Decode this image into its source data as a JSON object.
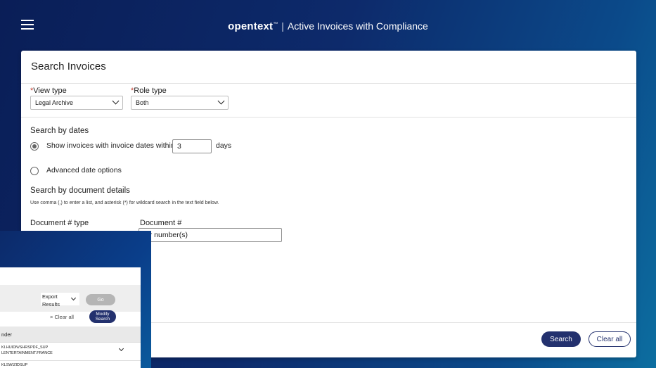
{
  "header": {
    "brand": "opentext",
    "tm": "™",
    "separator": "|",
    "title": "Active Invoices with Compliance"
  },
  "panel": {
    "title": "Search Invoices",
    "view_type": {
      "label": "View type",
      "required": "*",
      "value": "Legal Archive"
    },
    "role_type": {
      "label": "Role type",
      "required": "*",
      "value": "Both"
    },
    "dates": {
      "heading": "Search by dates",
      "option_within": "Show invoices with invoice dates within",
      "days_value": "3",
      "days_unit": "days",
      "option_advanced": "Advanced date options"
    },
    "doc": {
      "heading": "Search by document details",
      "hint": "Use comma (,) to enter a list, and asterisk (*) for wildcard search in the text field below.",
      "doc_type_label": "Document # type",
      "doc_num_label": "Document #",
      "doc_num_placeholder": "Enter number(s)",
      "doc_num_visible": "ter number(s)"
    },
    "buttons": {
      "search": "Search",
      "clear_all": "Clear all"
    }
  },
  "overlay": {
    "export": "Export",
    "results": "Results",
    "go": "Go",
    "clear": "× Clear all",
    "modify": "Modify",
    "search": "Search",
    "column": "nder",
    "row1_line1": "KI.HUIDN/SHRSPDF_SUP",
    "row1_line2": "LENTERTAINMENT.FRANCE",
    "row2_line1": "KLSWIZIDSUP"
  }
}
